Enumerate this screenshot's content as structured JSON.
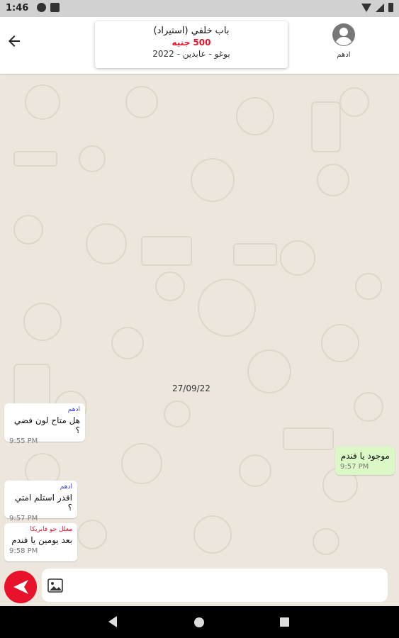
{
  "status_bar": {
    "time": "1:46"
  },
  "header": {
    "item_title": "باب خلفي (استيراد)",
    "price": "500 جنيه",
    "details": "بوغو - عابدين - 2022",
    "user_name": "ادهم"
  },
  "chat": {
    "date_separator": "27/09/22",
    "messages": [
      {
        "sender": "ادهم",
        "text": "هل متاح لون فضي ؟",
        "time": "9:55 PM",
        "direction": "incoming"
      },
      {
        "sender": "",
        "text": "موجود يا فندم",
        "time": "9:57 PM",
        "direction": "outgoing"
      },
      {
        "sender": "ادهم",
        "text": "اقدر استلم امتي ؟",
        "time": "9:57 PM",
        "direction": "incoming"
      },
      {
        "sender": "معلل جو فابريكا",
        "text": "بعد يومين يا فندم",
        "time": "9:58 PM",
        "direction": "incoming"
      }
    ]
  },
  "composer": {
    "placeholder": "",
    "value": ""
  },
  "colors": {
    "accent": "#e8132a",
    "outgoing_bubble": "#dcf8c6",
    "background": "#ece6dc"
  }
}
